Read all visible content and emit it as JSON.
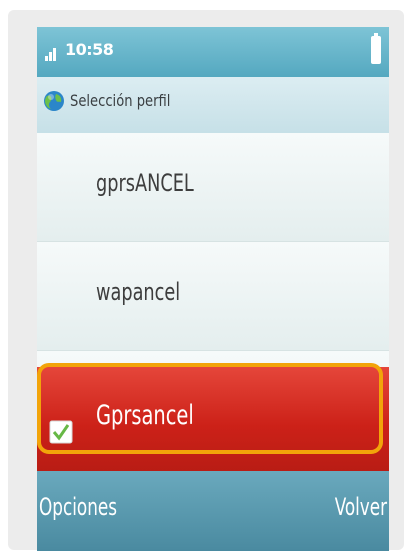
{
  "status_bar": {
    "time": "10:58",
    "signal_icon": "signal-bars-icon",
    "battery_icon": "battery-icon"
  },
  "header": {
    "icon": "globe-icon",
    "title": "Selección perfil"
  },
  "profiles": {
    "items": [
      {
        "label": "gprsANCEL",
        "checked": false
      },
      {
        "label": "wapancel",
        "checked": false
      },
      {
        "label": "Gprsancel",
        "checked": true
      }
    ]
  },
  "softkeys": {
    "left_label": "Opciones",
    "right_label": "Volver"
  },
  "colors": {
    "status_bar": "#5fb1c8",
    "selected_item": "#cc2118",
    "highlight_outline": "#f2a40a",
    "softkey_bar": "#5a99ae"
  }
}
